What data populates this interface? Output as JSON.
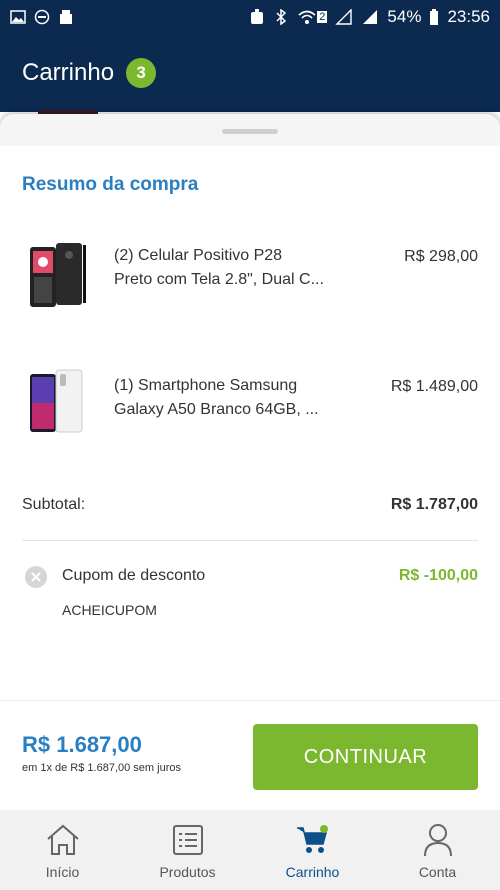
{
  "statusbar": {
    "battery": "54%",
    "time": "23:56",
    "sim_badge": "2",
    "left_icons": [
      "image-icon",
      "minus-circle-icon",
      "android-icon"
    ],
    "right_icons": [
      "alarm-icon",
      "bluetooth-icon",
      "wifi-icon",
      "signal-icon",
      "signal-icon",
      "battery-icon"
    ]
  },
  "header": {
    "title": "Carrinho",
    "cart_count": "3"
  },
  "summary": {
    "title": "Resumo da compra",
    "items": [
      {
        "name_line1": "(2) Celular Positivo P28",
        "name_line2": "Preto com Tela 2.8\", Dual C...",
        "price": "R$ 298,00",
        "image": "phone-image"
      },
      {
        "name_line1": "(1) Smartphone Samsung",
        "name_line2": "Galaxy A50 Branco 64GB, ...",
        "price": "R$ 1.489,00",
        "image": "smartphone-image"
      }
    ],
    "subtotal_label": "Subtotal:",
    "subtotal_value": "R$ 1.787,00",
    "coupon_label": "Cupom de desconto",
    "coupon_value": "R$ -100,00",
    "coupon_code": "ACHEICUPOM"
  },
  "checkout": {
    "total": "R$ 1.687,00",
    "installments": "em 1x de R$ 1.687,00 sem juros",
    "continue_label": "CONTINUAR"
  },
  "nav": {
    "items": [
      {
        "label": "Início",
        "icon": "home-icon"
      },
      {
        "label": "Produtos",
        "icon": "list-icon"
      },
      {
        "label": "Carrinho",
        "icon": "cart-icon"
      },
      {
        "label": "Conta",
        "icon": "user-icon"
      }
    ]
  },
  "colors": {
    "header_bg": "#0c2a50",
    "accent_blue": "#2a7fc1",
    "accent_green": "#7cb82f",
    "nav_active": "#0c4f8a"
  }
}
